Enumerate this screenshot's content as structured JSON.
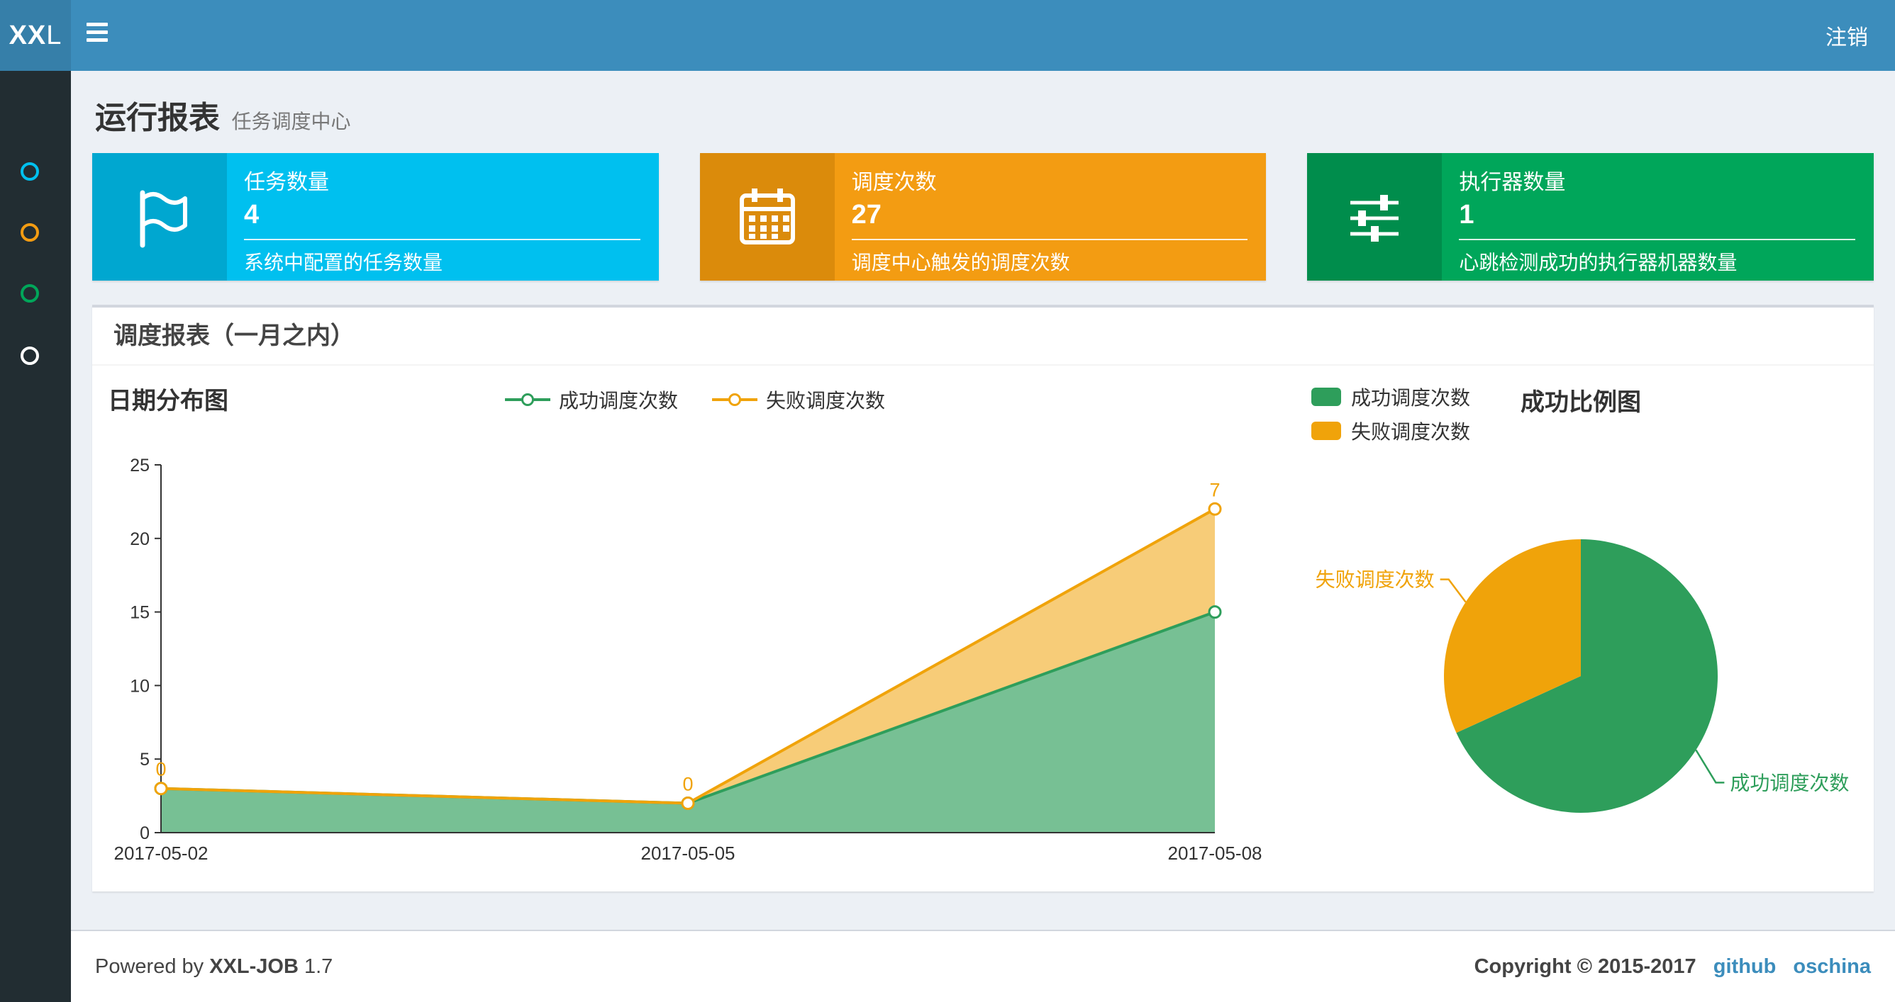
{
  "navbar": {
    "logo_bold": "XX",
    "logo_light": "L",
    "logout_label": "注销"
  },
  "sidebar": {
    "icon_colors": [
      "#00c0ef",
      "#f39c12",
      "#00a65a",
      "#ffffff"
    ]
  },
  "page_header": {
    "title": "运行报表",
    "subtitle": "任务调度中心"
  },
  "info_boxes": [
    {
      "title": "任务数量",
      "value": "4",
      "description": "系统中配置的任务数量",
      "bg": "#00c0ef",
      "icon_bg": "#00a7d0",
      "icon": "flag-icon"
    },
    {
      "title": "调度次数",
      "value": "27",
      "description": "调度中心触发的调度次数",
      "bg": "#f39c12",
      "icon_bg": "#db8b0b",
      "icon": "calendar-icon"
    },
    {
      "title": "执行器数量",
      "value": "1",
      "description": "心跳检测成功的执行器机器数量",
      "bg": "#00a65a",
      "icon_bg": "#008d4c",
      "icon": "sliders-icon"
    }
  ],
  "panel": {
    "title": "调度报表（一月之内）"
  },
  "chart_data": [
    {
      "type": "area",
      "title": "日期分布图",
      "categories": [
        "2017-05-02",
        "2017-05-05",
        "2017-05-08"
      ],
      "series": [
        {
          "name": "成功调度次数",
          "values": [
            3,
            2,
            15
          ],
          "color": "#2E9E5B"
        },
        {
          "name": "失败调度次数",
          "values": [
            0,
            0,
            7
          ],
          "color": "#F0A30A"
        }
      ],
      "stacked": true,
      "ylim": [
        0,
        25
      ],
      "yticks": [
        0,
        5,
        10,
        15,
        20,
        25
      ],
      "point_labels": {
        "series": "失败调度次数",
        "values": [
          "0",
          "0",
          "7"
        ]
      },
      "legend_position": "top",
      "grid": false
    },
    {
      "type": "pie",
      "title": "成功比例图",
      "slices": [
        {
          "label": "成功调度次数",
          "value": 15,
          "color": "#2E9E5B"
        },
        {
          "label": "失败调度次数",
          "value": 7,
          "color": "#F0A30A"
        }
      ],
      "legend_position": "top-left"
    }
  ],
  "footer": {
    "powered_prefix": "Powered by",
    "product": "XXL-JOB",
    "version": "1.7",
    "copyright": "Copyright © 2015-2017",
    "links": [
      {
        "label": "github"
      },
      {
        "label": "oschina"
      }
    ]
  }
}
